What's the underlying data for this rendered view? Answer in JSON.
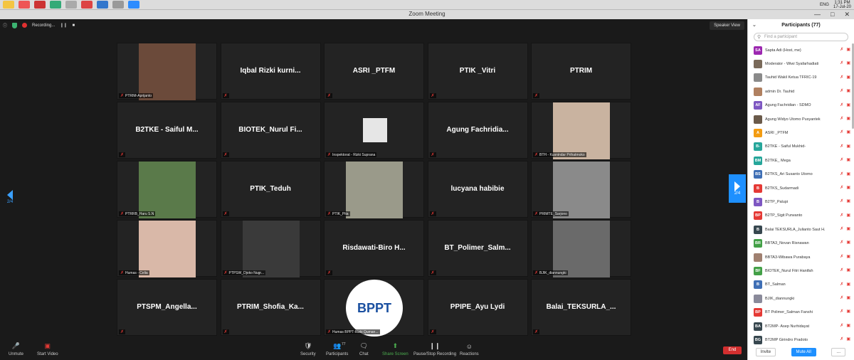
{
  "window": {
    "title": "Zoom Meeting"
  },
  "system_tray": {
    "lang": "ENG",
    "time": "1:31 PM",
    "date": "17-Jul-20"
  },
  "top_info": {
    "recording_label": "Recording..."
  },
  "speaker_view_label": "Speaker View",
  "pagination": {
    "left": "2/4",
    "right": "2/4"
  },
  "tiles": [
    {
      "label": "PTRIM-Aprijanto",
      "name": "",
      "photo": "#6b4a3a"
    },
    {
      "label": "",
      "name": "Iqbal Rizki kurni...",
      "photo": ""
    },
    {
      "label": "",
      "name": "ASRI _PTFM",
      "photo": ""
    },
    {
      "label": "",
      "name": "PTIK _Vitri",
      "photo": ""
    },
    {
      "label": "",
      "name": "PTRIM",
      "photo": ""
    },
    {
      "label": "",
      "name": "B2TKE - Saiful M...",
      "photo": ""
    },
    {
      "label": "",
      "name": "BIOTEK_Nurul Fi...",
      "photo": ""
    },
    {
      "label": "Inspektorat - Rizki Suprana",
      "name": "",
      "photo": "#e6e6e6"
    },
    {
      "label": "",
      "name": "Agung Fachridia...",
      "photo": ""
    },
    {
      "label": "BTH - Kusnindar Prihatmoko",
      "name": "",
      "photo": "#c9b3a0"
    },
    {
      "label": "PTRRB_Haru S.N",
      "name": "",
      "photo": "#5a7a4a"
    },
    {
      "label": "",
      "name": "PTIK_Teduh",
      "photo": ""
    },
    {
      "label": "PTIK_Pita",
      "name": "",
      "photo": "#9a9a8a"
    },
    {
      "label": "",
      "name": "lucyana habibie",
      "photo": ""
    },
    {
      "label": "PRIMTE_Sarjono",
      "name": "",
      "photo": "#8a8a8a"
    },
    {
      "label": "Humas - Celia",
      "name": "",
      "photo": "#d9b8a8"
    },
    {
      "label": "PTPSW_Djoko Nugr...",
      "name": "",
      "photo": "#3a3a3a"
    },
    {
      "label": "",
      "name": "Risdawati-Biro H...",
      "photo": ""
    },
    {
      "label": "",
      "name": "BT_Polimer_Salm...",
      "photo": ""
    },
    {
      "label": "BJIK_diannungki",
      "name": "",
      "photo": "#6a6a6a"
    },
    {
      "label": "",
      "name": "PTSPM_Angella...",
      "photo": ""
    },
    {
      "label": "",
      "name": "PTRIM_Shofia_Ka...",
      "photo": ""
    },
    {
      "label": "Humas BPPT-Rizki Quman...",
      "name": "",
      "photo": "logo"
    },
    {
      "label": "",
      "name": "PPIPE_Ayu Lydi",
      "photo": ""
    },
    {
      "label": "",
      "name": "Balai_TEKSURLA_...",
      "photo": ""
    }
  ],
  "bppt_logo": {
    "text": "BPPT"
  },
  "toolbar": {
    "unmute": "Unmute",
    "start_video": "Start Video",
    "security": "Security",
    "participants": "Participants",
    "participants_count": "77",
    "chat": "Chat",
    "share_screen": "Share Screen",
    "record": "Pause/Stop Recording",
    "reactions": "Reactions",
    "end": "End"
  },
  "panel": {
    "title": "Participants (77)",
    "search_placeholder": "Find a participant",
    "invite": "Invite",
    "mute_all": "Mute All",
    "participants": [
      {
        "initials": "SA",
        "color": "#9c27b0",
        "name": "Sapta Adi (Host, me)"
      },
      {
        "initials": "",
        "color": "#7a6a5a",
        "name": "Moderator - Wiwi Syafarhadiati"
      },
      {
        "initials": "",
        "color": "#8a8a8a",
        "name": "Tauhid Wakil Ketua TFRIC-19"
      },
      {
        "initials": "",
        "color": "#b08060",
        "name": "admin Dr. Tauhid"
      },
      {
        "initials": "AF",
        "color": "#7e57c2",
        "name": "Agung Fachridian - SDMO"
      },
      {
        "initials": "",
        "color": "#6a5a4a",
        "name": "Agung Widyo Utomo Pusyantek"
      },
      {
        "initials": "A",
        "color": "#f39c12",
        "name": "ASRI _PTFM"
      },
      {
        "initials": "B-",
        "color": "#26a69a",
        "name": "B2TKE - Saiful Mukhid-"
      },
      {
        "initials": "BM",
        "color": "#26a69a",
        "name": "B2TKE_ Mega"
      },
      {
        "initials": "BS",
        "color": "#3f6fb5",
        "name": "B2TKS_Ari Susanto Utomo"
      },
      {
        "initials": "B",
        "color": "#e53935",
        "name": "B2TKS_Sudarmadi"
      },
      {
        "initials": "B",
        "color": "#7e57c2",
        "name": "B2TP_Palupi"
      },
      {
        "initials": "BP",
        "color": "#e53935",
        "name": "B2TP_Sigit Purwanto"
      },
      {
        "initials": "B",
        "color": "#37474f",
        "name": "Balai TEKSURLA_Julianto Saut H."
      },
      {
        "initials": "BR",
        "color": "#43a047",
        "name": "BBTA3_Novan Risnawan"
      },
      {
        "initials": "",
        "color": "#a08070",
        "name": "BBTA3-Wibawa Purabaya"
      },
      {
        "initials": "BF",
        "color": "#43a047",
        "name": "BIOTEK_Nurul Fitri Hanifah"
      },
      {
        "initials": "B",
        "color": "#3f6fb5",
        "name": "BT_Salman"
      },
      {
        "initials": "",
        "color": "#8a8a9a",
        "name": "BJIK_diannungki"
      },
      {
        "initials": "BP",
        "color": "#e53935",
        "name": "BT Polimer_Salman Fanshi"
      },
      {
        "initials": "BA",
        "color": "#37474f",
        "name": "BT2MP- Asep Nurhidayat"
      },
      {
        "initials": "BG",
        "color": "#37474f",
        "name": "BT2MP Girindro Pradoto"
      }
    ]
  }
}
